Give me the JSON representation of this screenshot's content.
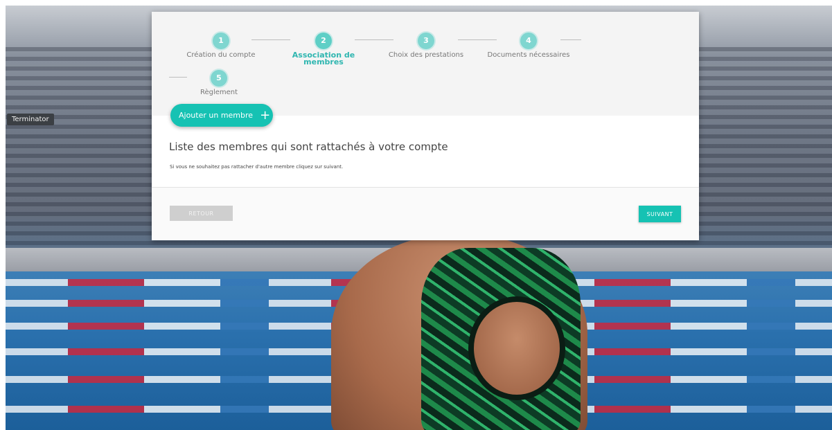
{
  "tooltip": {
    "text": "Terminator"
  },
  "stepper": {
    "steps": [
      {
        "number": "1",
        "label": "Création du compte"
      },
      {
        "number": "2",
        "label": "Association de membres"
      },
      {
        "number": "3",
        "label": "Choix des prestations"
      },
      {
        "number": "4",
        "label": "Documents nécessaires"
      },
      {
        "number": "5",
        "label": "Règlement"
      }
    ],
    "active_step": 2
  },
  "actions": {
    "add_member_label": "Ajouter un membre",
    "add_member_icon": "plus-icon"
  },
  "content": {
    "title": "Liste des membres qui sont rattachés à votre compte",
    "hint": "Si vous ne souhaitez pas rattacher d'autre membre cliquez sur suivant."
  },
  "footer": {
    "back_label": "RETOUR",
    "next_label": "SUIVANT"
  },
  "colors": {
    "accent": "#16c2b3",
    "step_circle": "#7fd6d0",
    "active_label": "#2fb6b0",
    "disabled_button": "#cfcfcf"
  }
}
